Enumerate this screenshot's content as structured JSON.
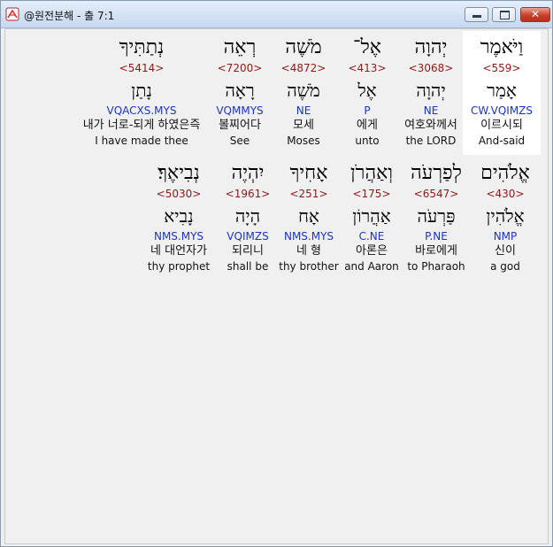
{
  "window": {
    "title": "@원전분해 - 출 7:1",
    "controls": {
      "minimize": "minimize",
      "maximize": "maximize",
      "close": "✕"
    }
  },
  "rows": [
    {
      "words": [
        {
          "hebrew": "וַיֹּאמֶר",
          "strong": "<559>",
          "lemma": "אָמַר",
          "morph": "CW.VQIMZS",
          "korean": "이르시되",
          "english": "And-said",
          "selected": true
        },
        {
          "hebrew": "יְהוָה",
          "strong": "<3068>",
          "lemma": "יְהוָה",
          "morph": "NE",
          "korean": "여호와께서",
          "english": "the LORD"
        },
        {
          "hebrew": "אֶל־",
          "strong": "<413>",
          "lemma": "אֶל",
          "morph": "P",
          "korean": "에게",
          "english": "unto"
        },
        {
          "hebrew": "מֹשֶׁה",
          "strong": "<4872>",
          "lemma": "מֹשֶׁה",
          "morph": "NE",
          "korean": "모세",
          "english": "Moses"
        },
        {
          "hebrew": "רְאֵה",
          "strong": "<7200>",
          "lemma": "רָאָה",
          "morph": "VQMMYS",
          "korean": "볼찌어다",
          "english": "See"
        },
        {
          "hebrew": "נְתַתִּיךָ",
          "strong": "<5414>",
          "lemma": "נָתַן",
          "morph": "VQACXS.MYS",
          "korean": "내가 너로-되게 하였은즉",
          "english": "I have made thee"
        }
      ]
    },
    {
      "words": [
        {
          "hebrew": "אֱלֹהִים",
          "strong": "<430>",
          "lemma": "אֱלֹהִין",
          "morph": "NMP",
          "korean": "신이",
          "english": "a god"
        },
        {
          "hebrew": "לְפַרְעֹה",
          "strong": "<6547>",
          "lemma": "פַּרְעֹה",
          "morph": "P.NE",
          "korean": "바로에게",
          "english": "to Pharaoh"
        },
        {
          "hebrew": "וְאַהֲרֹן",
          "strong": "<175>",
          "lemma": "אַהֲרוֹן",
          "morph": "C.NE",
          "korean": "아론은",
          "english": "and Aaron"
        },
        {
          "hebrew": "אָחִיךָ",
          "strong": "<251>",
          "lemma": "אָח",
          "morph": "NMS.MYS",
          "korean": "네 형",
          "english": "thy brother"
        },
        {
          "hebrew": "יִהְיֶה",
          "strong": "<1961>",
          "lemma": "הָיָה",
          "morph": "VQIMZS",
          "korean": "되리니",
          "english": "shall be"
        },
        {
          "hebrew": "נְבִיאֶךָ׃",
          "strong": "<5030>",
          "lemma": "נָבִיא",
          "morph": "NMS.MYS",
          "korean": "네 대언자가",
          "english": "thy prophet"
        }
      ]
    }
  ],
  "colors": {
    "strong": "#8b1a1a",
    "morph": "#1a33c8",
    "selected_bg": "#ffffff"
  }
}
